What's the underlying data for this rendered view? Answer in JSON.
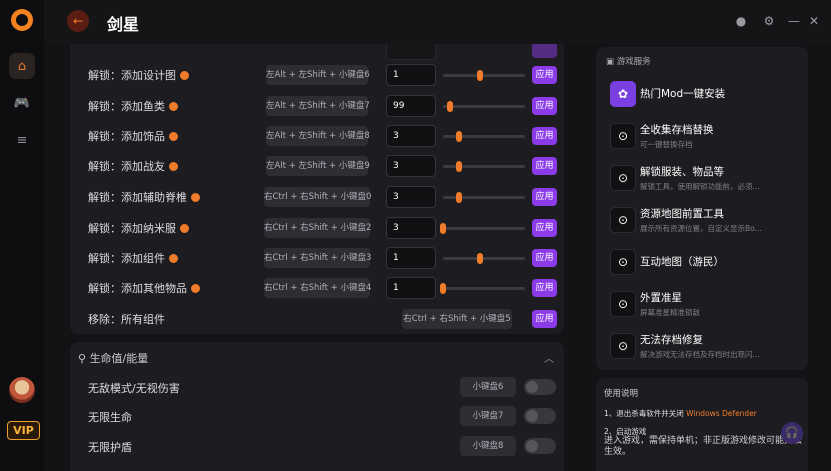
{
  "header": {
    "title": "剑星"
  },
  "sidebar": {
    "vip_label": "VIP"
  },
  "unlock_rows": [
    {
      "label": "解锁：添加设计图",
      "hotkey": "左Alt + 左Shift + 小键盘6",
      "value": "1",
      "slider": 0.45,
      "apply": "应用",
      "dot": true
    },
    {
      "label": "解锁：添加鱼类",
      "hotkey": "左Alt + 左Shift + 小键盘7",
      "value": "99",
      "slider": 0.08,
      "apply": "应用",
      "dot": true
    },
    {
      "label": "解锁：添加饰品",
      "hotkey": "左Alt + 左Shift + 小键盘8",
      "value": "3",
      "slider": 0.2,
      "apply": "应用",
      "dot": true
    },
    {
      "label": "解锁：添加战友",
      "hotkey": "左Alt + 左Shift + 小键盘9",
      "value": "3",
      "slider": 0.2,
      "apply": "应用",
      "dot": true
    },
    {
      "label": "解锁：添加辅助脊椎",
      "hotkey": "右Ctrl + 右Shift + 小键盘0",
      "value": "3",
      "slider": 0.2,
      "apply": "应用",
      "dot": true
    },
    {
      "label": "解锁：添加纳米服",
      "hotkey": "右Ctrl + 右Shift + 小键盘2",
      "value": "3",
      "slider": 0.0,
      "apply": "应用",
      "dot": true
    },
    {
      "label": "解锁：添加组件",
      "hotkey": "右Ctrl + 右Shift + 小键盘3",
      "value": "1",
      "slider": 0.45,
      "apply": "应用",
      "dot": true
    },
    {
      "label": "解锁：添加其他物品",
      "hotkey": "右Ctrl + 右Shift + 小键盘4",
      "value": "1",
      "slider": 0.0,
      "apply": "应用",
      "dot": true
    }
  ],
  "remove_row": {
    "label": "移除：所有组件",
    "hotkey": "右Ctrl + 右Shift + 小键盘5",
    "apply": "应用"
  },
  "health_section": {
    "title": "生命值/能量",
    "rows": [
      {
        "label": "无敌模式/无视伤害",
        "hotkey": "小键盘6"
      },
      {
        "label": "无限生命",
        "hotkey": "小键盘7"
      },
      {
        "label": "无限护盾",
        "hotkey": "小键盘8"
      }
    ]
  },
  "services": {
    "title": "游戏服务",
    "items": [
      {
        "title": "热门Mod一键安装",
        "desc": ""
      },
      {
        "title": "全收集存档替换",
        "desc": "可一键替换存档"
      },
      {
        "title": "解锁服装、物品等",
        "desc": "解锁工具，使用解锁功能前，必须..."
      },
      {
        "title": "资源地图前置工具",
        "desc": "展示所有资源位置，自定义显示Bo..."
      },
      {
        "title": "互动地图（游民）",
        "desc": ""
      },
      {
        "title": "外置准星",
        "desc": "屏幕准星精准锁敌"
      },
      {
        "title": "无法存档修复",
        "desc": "解决游戏无法存档及存档时出现闪..."
      }
    ]
  },
  "guide": {
    "title": "使用说明",
    "step1_prefix": "1、退出杀毒软件并关闭",
    "step1_highlight": "Windows Defender",
    "step2": "2、启动游戏",
    "step2_desc": "进入游戏，需保持单机；非正版游戏修改可能无法生效。"
  }
}
